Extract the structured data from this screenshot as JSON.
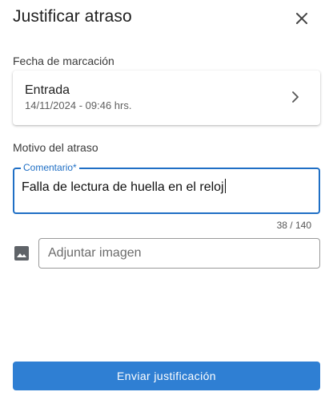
{
  "header": {
    "title": "Justificar atraso",
    "close_icon": "close-icon"
  },
  "marking": {
    "section_label": "Fecha de marcación",
    "type": "Entrada",
    "datetime": "14/11/2024 - 09:46 hrs.",
    "chevron_icon": "chevron-right-icon"
  },
  "reason": {
    "section_label": "Motivo del atraso",
    "comment_label": "Comentario*",
    "comment_value": "Falla de lectura de huella en el reloj",
    "counter": "38 / 140"
  },
  "attachment": {
    "icon": "image-icon",
    "placeholder": "Adjuntar imagen"
  },
  "footer": {
    "submit_label": "Enviar justificación"
  },
  "colors": {
    "accent": "#1f6fc5",
    "button": "#2f7fd3"
  }
}
